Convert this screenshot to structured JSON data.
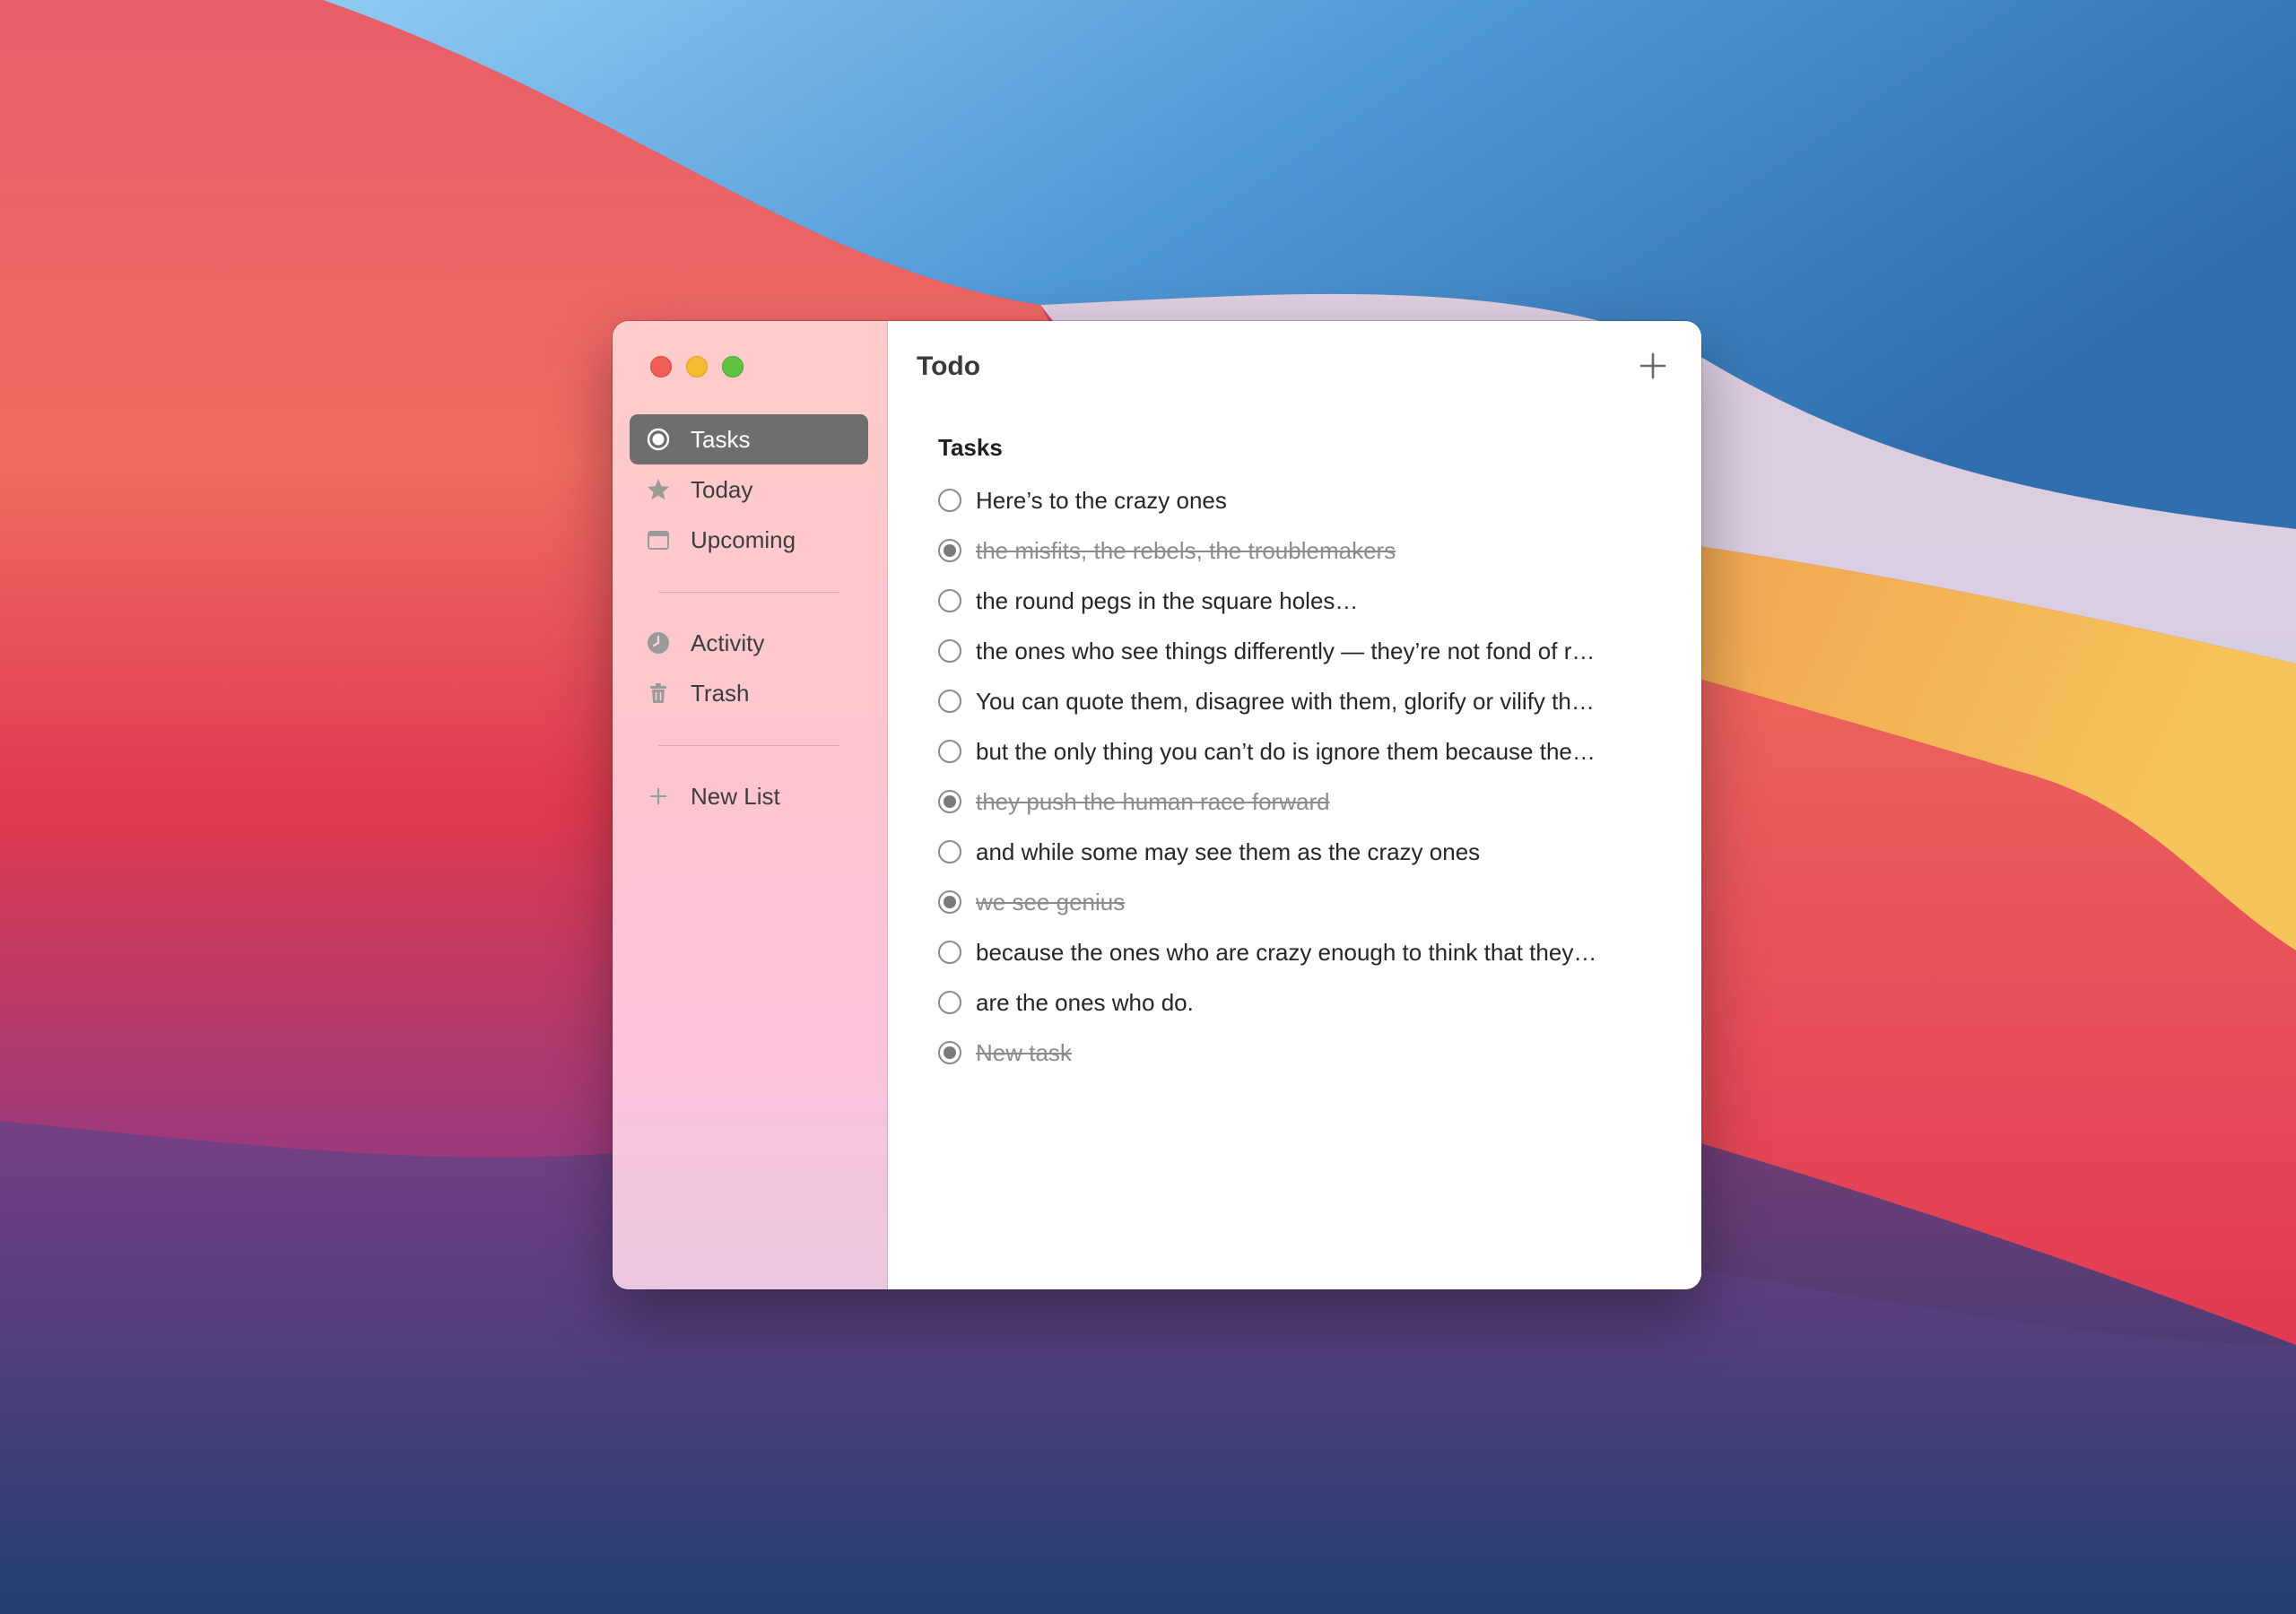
{
  "window": {
    "title": "Todo"
  },
  "sidebar": {
    "items": [
      {
        "label": "Tasks",
        "icon": "list-circle-icon",
        "selected": true
      },
      {
        "label": "Today",
        "icon": "star-icon",
        "selected": false
      },
      {
        "label": "Upcoming",
        "icon": "calendar-icon",
        "selected": false
      }
    ],
    "secondary_items": [
      {
        "label": "Activity",
        "icon": "clock-icon"
      },
      {
        "label": "Trash",
        "icon": "trash-icon"
      }
    ],
    "new_list_label": "New List"
  },
  "main": {
    "section_title": "Tasks",
    "tasks": [
      {
        "text": "Here’s to the crazy ones",
        "done": false
      },
      {
        "text": "the misfits, the rebels, the troublemakers",
        "done": true
      },
      {
        "text": "the round pegs in the square holes…",
        "done": false
      },
      {
        "text": "the ones who see things differently — they’re not fond of r…",
        "done": false
      },
      {
        "text": "You can quote them, disagree with them, glorify or vilify th…",
        "done": false
      },
      {
        "text": "but the only thing you can’t do is ignore them because the…",
        "done": false
      },
      {
        "text": "they push the human race forward",
        "done": true
      },
      {
        "text": "and while some may see them as the crazy ones",
        "done": false
      },
      {
        "text": "we see genius",
        "done": true
      },
      {
        "text": "because the ones who are crazy enough to think that they…",
        "done": false
      },
      {
        "text": "are the ones who do.",
        "done": false
      },
      {
        "text": "New task",
        "done": true
      }
    ]
  },
  "colors": {
    "selected_item_bg": "#6e6e6e",
    "close": "#ee5e56",
    "minimize": "#f5bc2f",
    "maximize": "#5fc340"
  }
}
